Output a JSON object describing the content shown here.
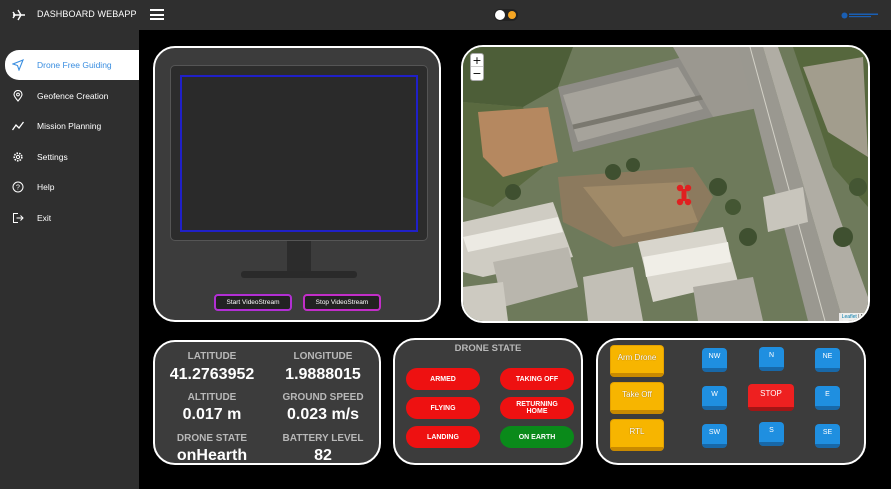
{
  "app": {
    "title": "DASHBOARD WEBAPP"
  },
  "sidebar": {
    "items": [
      {
        "label": "Drone Free Guiding",
        "icon": "navigation-arrow-icon",
        "active": true
      },
      {
        "label": "Geofence Creation",
        "icon": "map-pin-icon"
      },
      {
        "label": "Mission Planning",
        "icon": "chart-line-icon"
      },
      {
        "label": "Settings",
        "icon": "gear-icon"
      },
      {
        "label": "Help",
        "icon": "help-circle-icon"
      },
      {
        "label": "Exit",
        "icon": "exit-icon"
      }
    ]
  },
  "video": {
    "start_label": "Start VideoStream",
    "stop_label": "Stop VideoStream"
  },
  "map": {
    "zoom_in": "+",
    "zoom_out": "−",
    "attribution_link": "Leaflet",
    "attribution_sep": " | M",
    "marker_color": "#e02020"
  },
  "telemetry": {
    "latitude_label": "LATITUDE",
    "latitude_value": "41.2763952",
    "longitude_label": "LONGITUDE",
    "longitude_value": "1.9888015",
    "altitude_label": "ALTITUDE",
    "altitude_value": "0.017 m",
    "ground_speed_label": "GROUND SPEED",
    "ground_speed_value": "0.023 m/s",
    "drone_state_label": "DRONE STATE",
    "drone_state_value": "onHearth",
    "battery_label": "BATTERY LEVEL",
    "battery_value": "82"
  },
  "drone_state": {
    "title": "DRONE STATE",
    "armed": "ARMED",
    "taking_off": "TAKING OFF",
    "flying": "FLYING",
    "returning_home_1": "RETURNING",
    "returning_home_2": "HOME",
    "landing": "LANDING",
    "on_earth": "ON EARTH"
  },
  "controls": {
    "arm_drone": "Arm Drone",
    "take_off": "Take Off",
    "rtl": "RTL",
    "nw": "NW",
    "n": "N",
    "ne": "NE",
    "w": "W",
    "stop": "STOP",
    "e": "E",
    "sw": "SW",
    "s": "S",
    "se": "SE"
  },
  "colors": {
    "accent": "#3a8ee0",
    "pill_red": "#ee1111",
    "pill_green": "#0a8a1a",
    "control_yellow": "#f7b500",
    "control_blue": "#1f8fe0",
    "stop_red": "#ee2020"
  }
}
